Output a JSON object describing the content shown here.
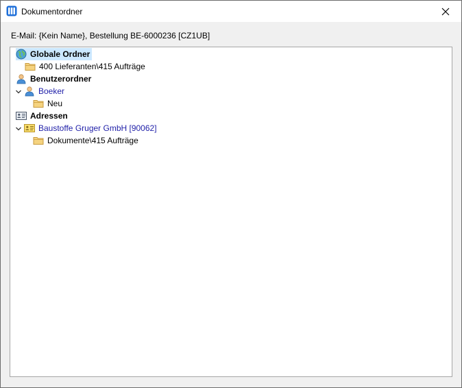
{
  "window": {
    "title": "Dokumentordner",
    "icon": "columns-app-icon",
    "close_icon": "close-icon"
  },
  "info_text": "E-Mail: {Kein Name}, Bestellung BE-6000236 [CZ1UB]",
  "tree": {
    "global_folders": {
      "label": "Globale Ordner",
      "icon": "globe-icon",
      "selected": true
    },
    "global_folder_1": {
      "label": "400 Lieferanten\\415 Aufträge",
      "icon": "folder-icon"
    },
    "user_folders": {
      "label": "Benutzerordner",
      "icon": "user-icon"
    },
    "user_boeker": {
      "label": "Boeker",
      "icon": "user-icon",
      "expanded": true
    },
    "user_folder_neu": {
      "label": "Neu",
      "icon": "folder-icon"
    },
    "addresses": {
      "label": "Adressen",
      "icon": "address-card-icon"
    },
    "address_1": {
      "label": "Baustoffe Gruger GmbH [90062]",
      "icon": "contact-card-icon",
      "expanded": true
    },
    "address_folder_1": {
      "label": "Dokumente\\415 Aufträge",
      "icon": "folder-icon"
    }
  },
  "colors": {
    "link": "#1f1fa8",
    "selection": "#cce8ff",
    "folder": "#f5d380"
  }
}
